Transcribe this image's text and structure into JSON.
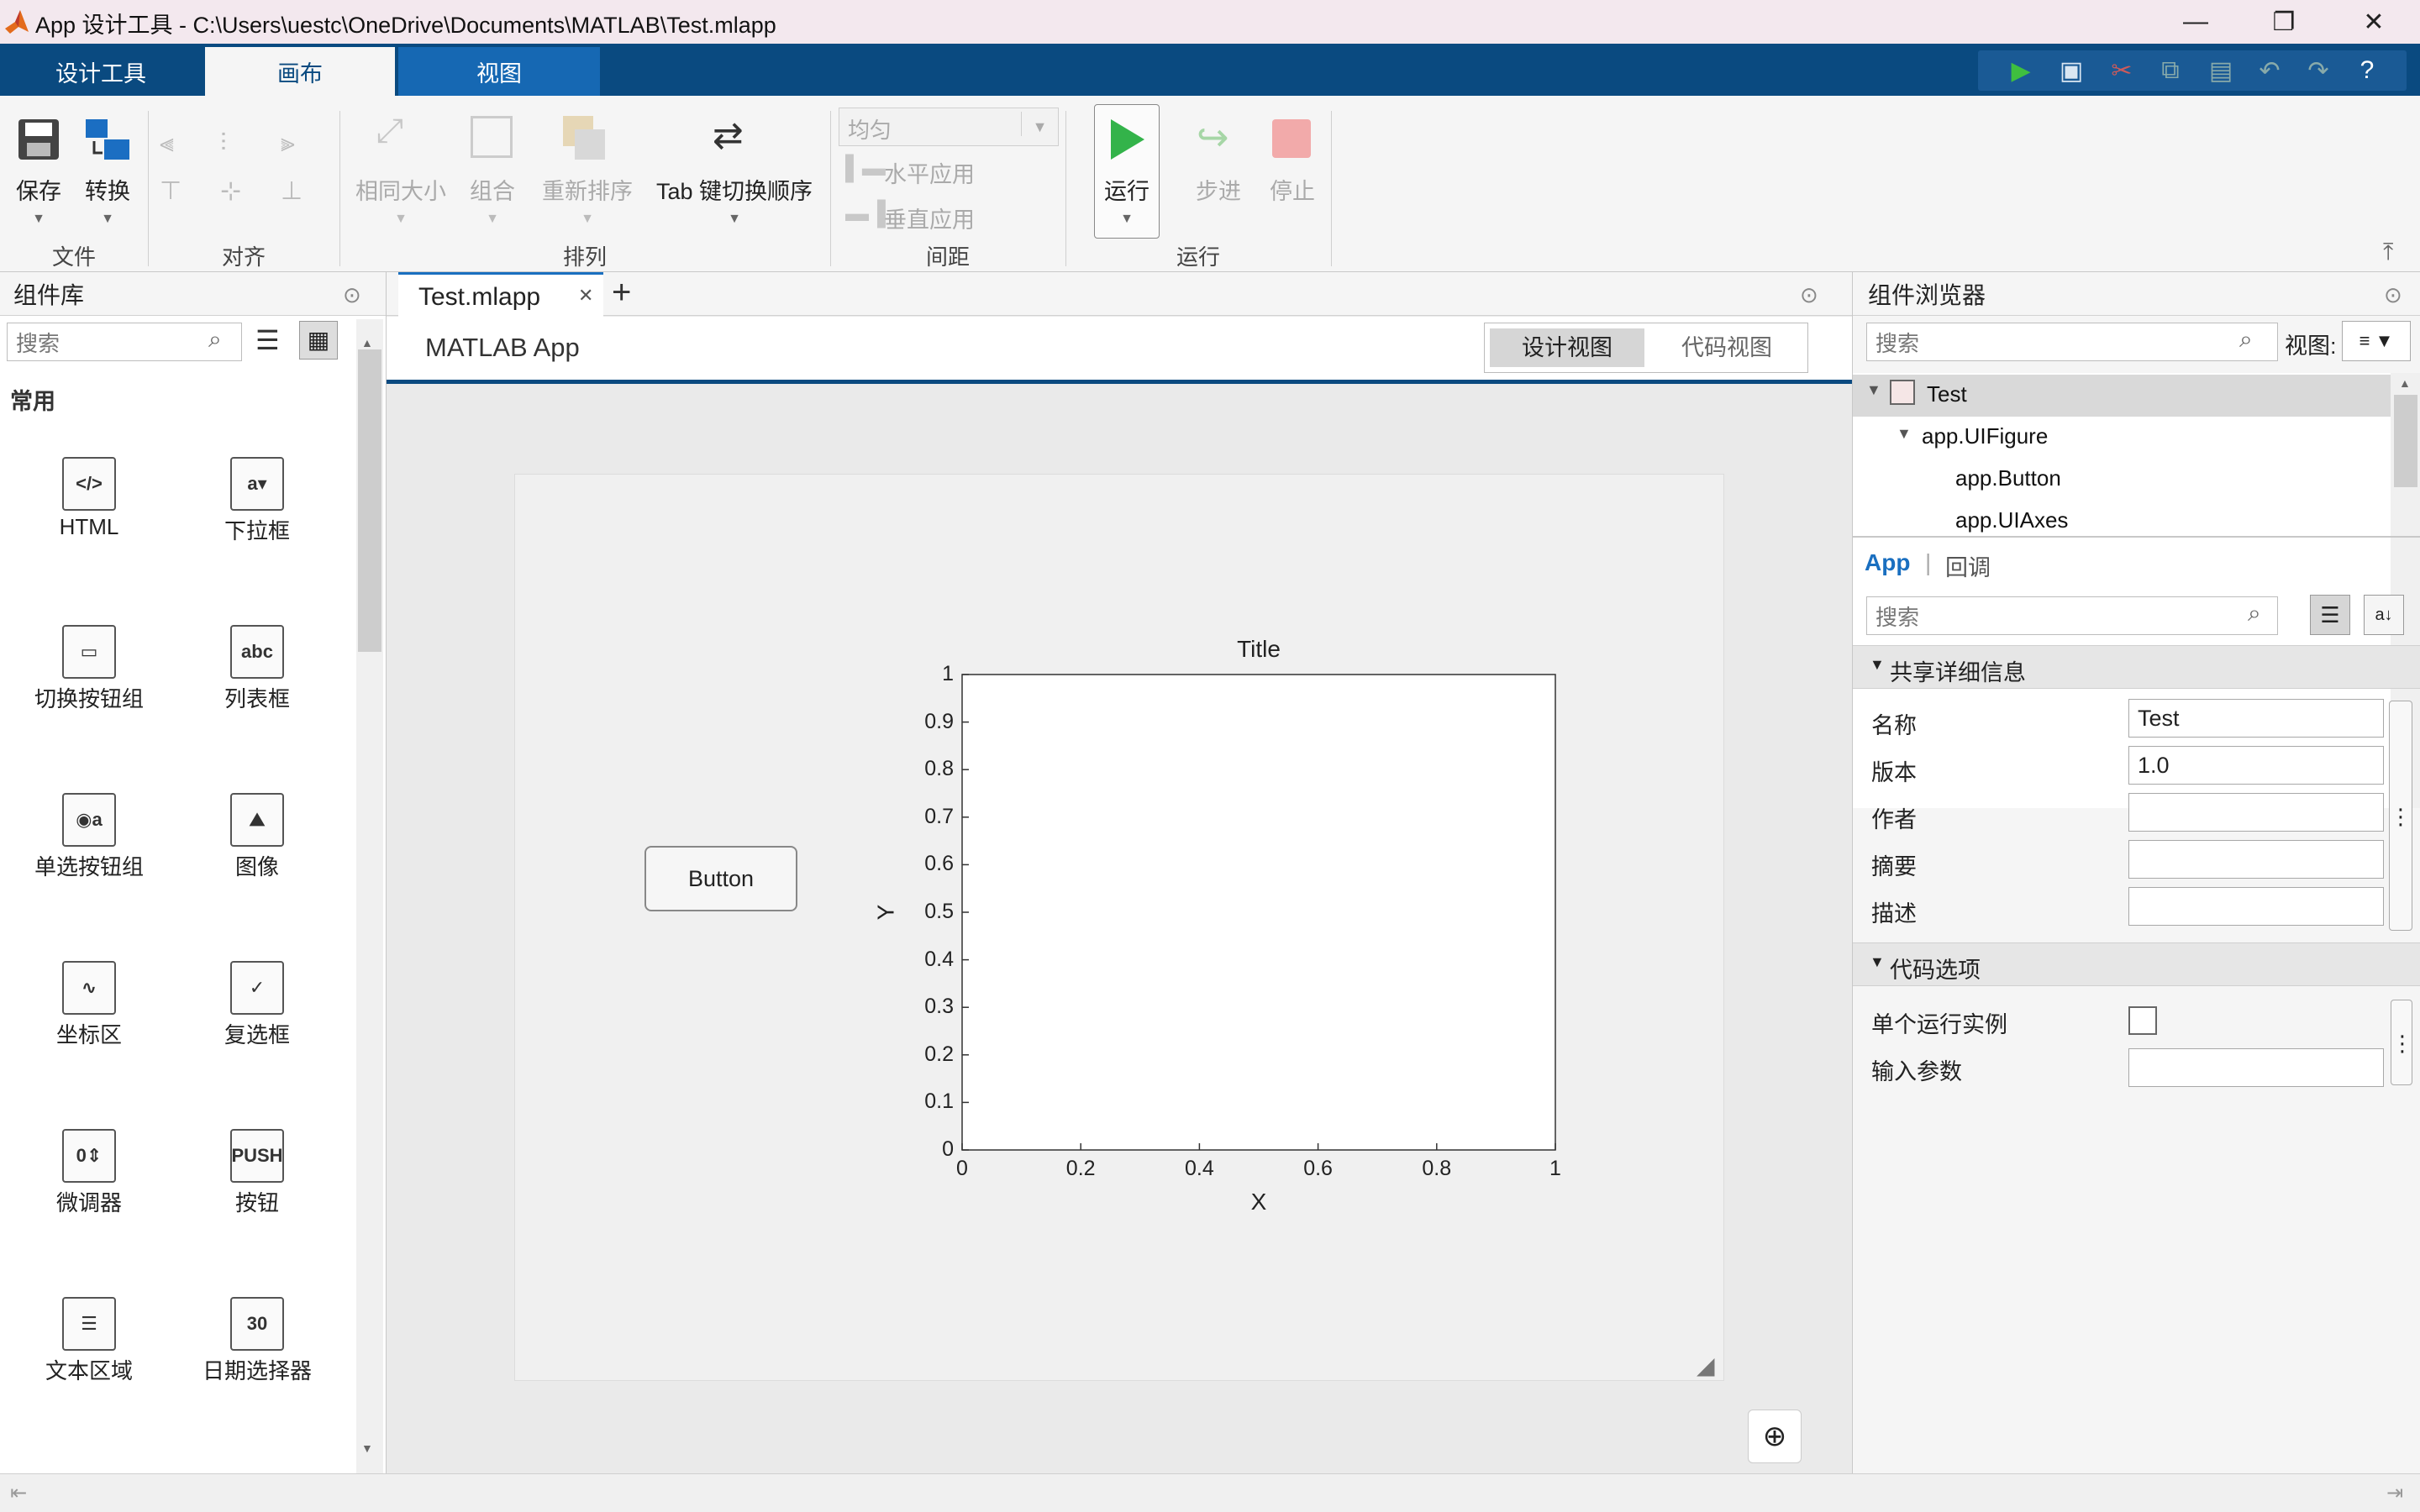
{
  "window": {
    "title": "App 设计工具 - C:\\Users\\uestc\\OneDrive\\Documents\\MATLAB\\Test.mlapp",
    "minimize_icon": "minimize-icon",
    "maximize_icon": "restore-icon",
    "close_icon": "close-icon"
  },
  "tabs": {
    "designer": "设计工具",
    "canvas": "画布",
    "view": "视图"
  },
  "ribbon": {
    "file": {
      "save": "保存",
      "convert": "转换",
      "section": "文件"
    },
    "align": {
      "section": "对齐"
    },
    "arrange": {
      "same_size": "相同大小",
      "group": "组合",
      "reorder": "重新排序",
      "tab_order": "Tab 键切换顺序",
      "section": "排列"
    },
    "spacing": {
      "select_value": "均匀",
      "horizontal": "水平应用",
      "vertical": "垂直应用",
      "section": "间距"
    },
    "run": {
      "run": "运行",
      "step": "步进",
      "stop": "停止",
      "section": "运行"
    }
  },
  "library": {
    "title": "组件库",
    "search_placeholder": "搜索",
    "category": "常用",
    "items": [
      {
        "label": "HTML",
        "icon": "</>"
      },
      {
        "label": "下拉框",
        "icon": "a▾"
      },
      {
        "label": "切换按钮组",
        "icon": "▭"
      },
      {
        "label": "列表框",
        "icon": "abc"
      },
      {
        "label": "单选按钮组",
        "icon": "◉a"
      },
      {
        "label": "图像",
        "icon": "⛰"
      },
      {
        "label": "坐标区",
        "icon": "∿"
      },
      {
        "label": "复选框",
        "icon": "✓"
      },
      {
        "label": "微调器",
        "icon": "0⇕"
      },
      {
        "label": "按钮",
        "icon": "PUSH"
      },
      {
        "label": "文本区域",
        "icon": "☰"
      },
      {
        "label": "日期选择器",
        "icon": "30"
      }
    ]
  },
  "document": {
    "tab_label": "Test.mlapp",
    "app_title": "MATLAB App",
    "design_view": "设计视图",
    "code_view": "代码视图",
    "button_label": "Button",
    "zoom_icon": "zoom-in-icon"
  },
  "chart_data": {
    "type": "line",
    "title": "Title",
    "xlabel": "X",
    "ylabel": "Y",
    "xlim": [
      0,
      1
    ],
    "ylim": [
      0,
      1
    ],
    "x_ticks": [
      "0",
      "0.2",
      "0.4",
      "0.6",
      "0.8",
      "1"
    ],
    "y_ticks": [
      "0",
      "0.1",
      "0.2",
      "0.3",
      "0.4",
      "0.5",
      "0.6",
      "0.7",
      "0.8",
      "0.9",
      "1"
    ],
    "series": []
  },
  "browser": {
    "title": "组件浏览器",
    "search_placeholder": "搜索",
    "view_label": "视图:",
    "tree": [
      "Test",
      "app.UIFigure",
      "app.Button",
      "app.UIAxes"
    ],
    "tab_app": "App",
    "tab_callback": "回调",
    "props_search_placeholder": "搜索",
    "section_shared": "共享详细信息",
    "section_code": "代码选项",
    "props": [
      {
        "label": "名称",
        "value": "Test"
      },
      {
        "label": "版本",
        "value": "1.0"
      },
      {
        "label": "作者",
        "value": ""
      },
      {
        "label": "摘要",
        "value": ""
      },
      {
        "label": "描述",
        "value": ""
      }
    ],
    "single_instance": "单个运行实例",
    "input_args": "输入参数"
  }
}
